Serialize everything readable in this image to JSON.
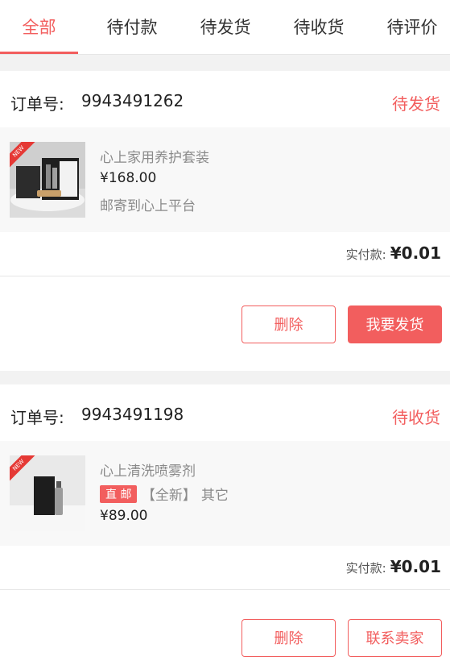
{
  "tabs": [
    {
      "label": "全部",
      "active": true
    },
    {
      "label": "待付款",
      "active": false
    },
    {
      "label": "待发货",
      "active": false
    },
    {
      "label": "待收货",
      "active": false
    },
    {
      "label": "待评价",
      "active": false
    }
  ],
  "colors": {
    "accent": "#f25e5e",
    "background": "#f2f2f2",
    "card": "#ffffff",
    "product_bg": "#f8f8f8"
  },
  "orders": [
    {
      "order_label": "订单号:",
      "order_no": "9943491262",
      "status": "待发货",
      "new_tag": "NEW",
      "product": {
        "name": "心上家用养护套装",
        "price": "¥168.00",
        "note": "邮寄到心上平台"
      },
      "paid_label": "实付款:",
      "paid_value": "¥0.01",
      "buttons": [
        "删除",
        "我要发货"
      ]
    },
    {
      "order_label": "订单号:",
      "order_no": "9943491198",
      "status": "待收货",
      "new_tag": "NEW",
      "product": {
        "name": "心上清洗喷雾剂",
        "badge": "直 邮",
        "condition": "【全新】",
        "category": "其它",
        "price": "¥89.00"
      },
      "paid_label": "实付款:",
      "paid_value": "¥0.01",
      "buttons": [
        "删除",
        "联系卖家"
      ]
    }
  ]
}
